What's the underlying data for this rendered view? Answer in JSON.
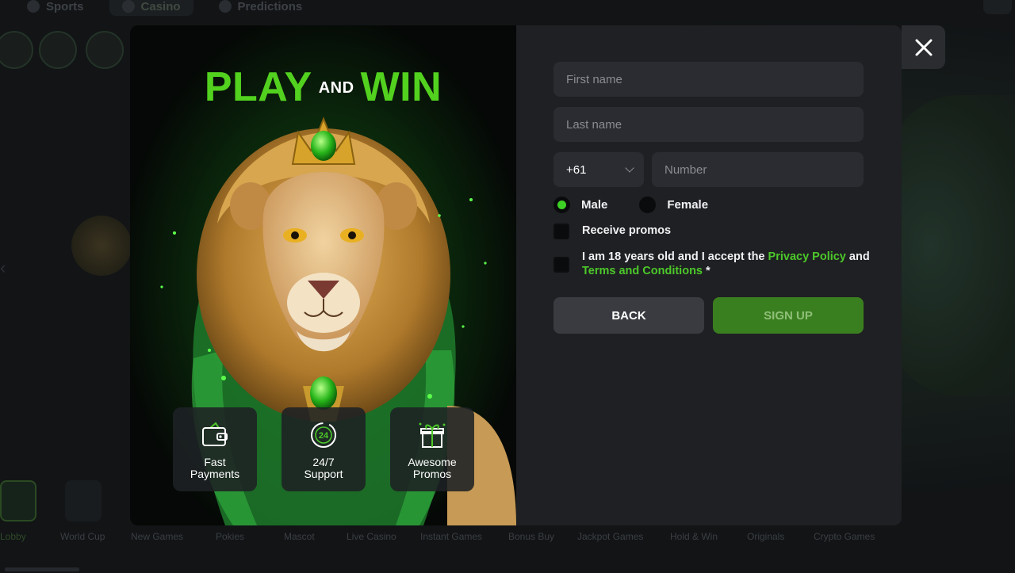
{
  "background": {
    "nav_tabs": [
      "Sports",
      "Casino",
      "Predictions"
    ],
    "categories": [
      "Lobby",
      "World Cup",
      "New Games",
      "Pokies",
      "Mascot",
      "Live Casino",
      "Instant Games",
      "Bonus Buy",
      "Jackpot Games",
      "Hold & Win",
      "Originals",
      "Crypto Games"
    ]
  },
  "promo": {
    "headline_play": "PLAY",
    "headline_and": "AND",
    "headline_win": "WIN",
    "features": [
      {
        "icon": "wallet-icon",
        "line1": "Fast",
        "line2": "Payments"
      },
      {
        "icon": "24-7-support-icon",
        "line1": "24/7",
        "line2": "Support"
      },
      {
        "icon": "gift-icon",
        "line1": "Awesome",
        "line2": "Promos"
      }
    ]
  },
  "form": {
    "first_name_placeholder": "First name",
    "last_name_placeholder": "Last name",
    "country_code": "+61",
    "number_placeholder": "Number",
    "gender_options": [
      "Male",
      "Female"
    ],
    "gender_selected": "Male",
    "receive_promos_label": "Receive promos",
    "terms_prefix": "I am 18 years old and I accept the",
    "privacy_link": "Privacy Policy",
    "terms_and": "and",
    "terms_link": "Terms and Conditions",
    "required_mark": " *",
    "back_label": "BACK",
    "signup_label": "SIGN UP"
  },
  "colors": {
    "accent_green": "#3ed125",
    "signup_bg": "#3a7f1f",
    "modal_bg": "#1f2023",
    "field_bg": "#2b2c31"
  }
}
